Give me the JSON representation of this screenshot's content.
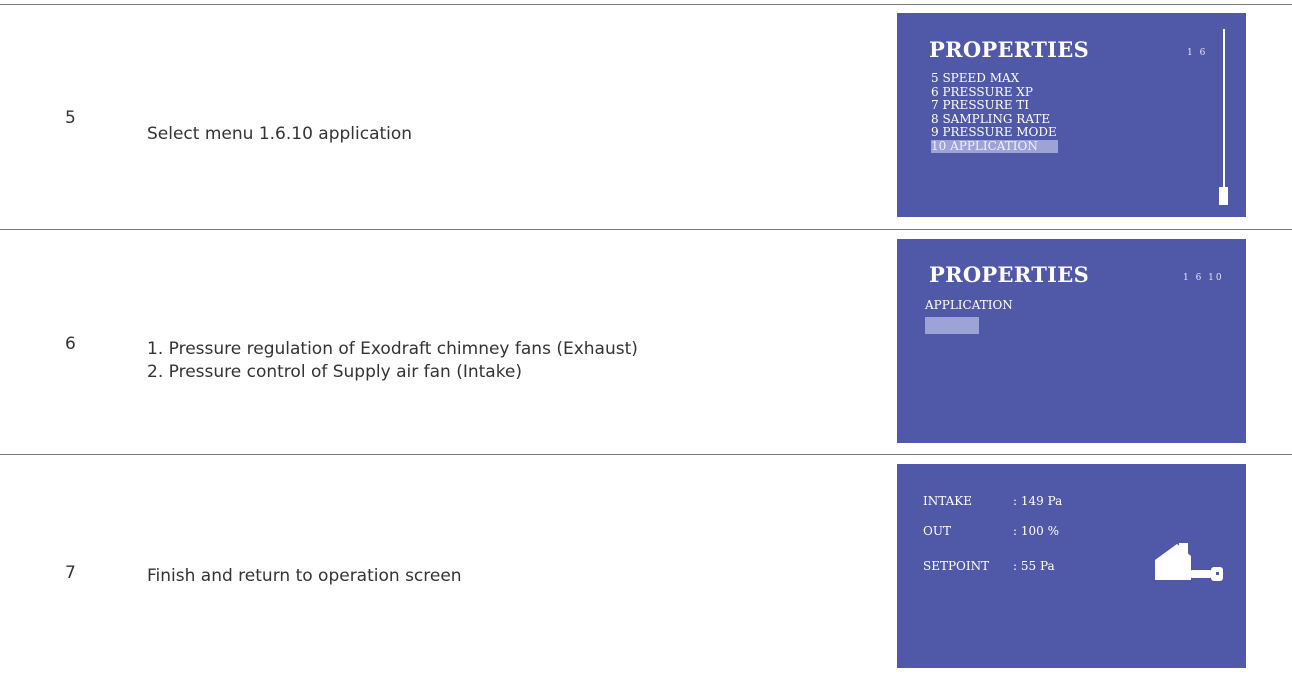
{
  "colors": {
    "lcd_background": "#5058a8",
    "selection_highlight": "#9da3d6"
  },
  "steps": [
    {
      "number": "5",
      "instruction": "Select menu 1.6.10 application",
      "display": {
        "title": "PROPERTIES",
        "menu_code": "1 6",
        "items": [
          "5 SPEED MAX",
          "6 PRESSURE XP",
          "7 PRESSURE TI",
          "8 SAMPLING RATE",
          "9 PRESSURE MODE",
          "10 APPLICATION"
        ],
        "selected_item": "10 APPLICATION"
      }
    },
    {
      "number": "6",
      "instruction_lines": [
        "1. Pressure regulation of Exodraft chimney fans (Exhaust)",
        "2. Pressure control of Supply air fan (Intake)"
      ],
      "display": {
        "title": "PROPERTIES",
        "menu_code": "1 6 10",
        "label": "APPLICATION"
      }
    },
    {
      "number": "7",
      "instruction": "Finish and return to operation screen",
      "display": {
        "rows": [
          {
            "label": "INTAKE",
            "value": ": 149 Pa"
          },
          {
            "label": "OUT",
            "value": ": 100 %"
          },
          {
            "label": "SETPOINT",
            "value": ": 55 Pa"
          }
        ],
        "icon": "house-fan-icon"
      }
    }
  ]
}
